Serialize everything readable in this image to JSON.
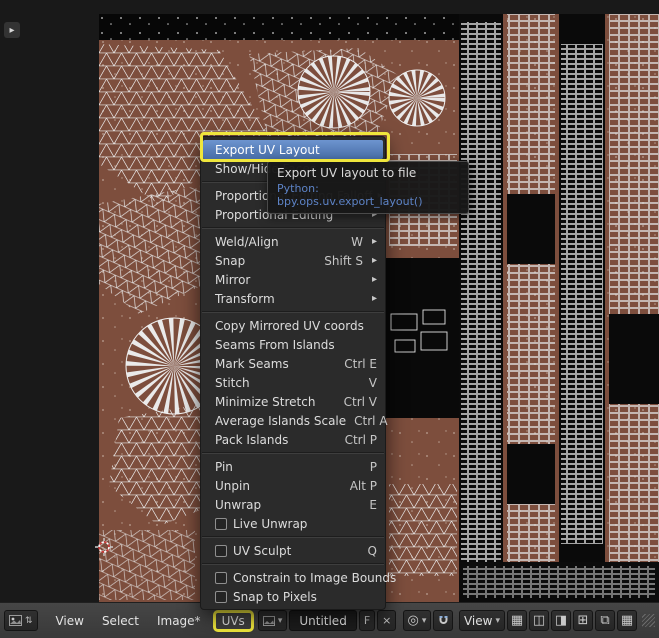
{
  "colors": {
    "canvas_brown": "#7d4e3d",
    "menu_bg": "#2b2b2b",
    "highlight_blue": "#5b83bd",
    "annotation_yellow": "#efe63c",
    "python_blue": "#5d83c6",
    "header_bg": "#3d3d3d"
  },
  "region": {
    "expand_arrow": "▸"
  },
  "tooltip": {
    "text": "Export UV layout to file",
    "python": "Python: bpy.ops.uv.export_layout()"
  },
  "menu": {
    "title": "UVs",
    "highlighted_item": "Export UV Layout",
    "items": [
      {
        "label": "Export UV Layout",
        "shortcut": ""
      },
      {
        "label": "Show/Hide Faces",
        "shortcut": ""
      },
      {
        "label": "Proportional Editing Falloff",
        "shortcut": ""
      },
      {
        "label": "Proportional Editing",
        "shortcut": ""
      },
      {
        "label": "Weld/Align",
        "shortcut": "W"
      },
      {
        "label": "Snap",
        "shortcut": "Shift S"
      },
      {
        "label": "Mirror",
        "shortcut": ""
      },
      {
        "label": "Transform",
        "shortcut": ""
      },
      {
        "label": "Copy Mirrored UV coords",
        "shortcut": ""
      },
      {
        "label": "Seams From Islands",
        "shortcut": ""
      },
      {
        "label": "Mark Seams",
        "shortcut": "Ctrl E"
      },
      {
        "label": "Stitch",
        "shortcut": "V"
      },
      {
        "label": "Minimize Stretch",
        "shortcut": "Ctrl V"
      },
      {
        "label": "Average Islands Scale",
        "shortcut": "Ctrl A"
      },
      {
        "label": "Pack Islands",
        "shortcut": "Ctrl P"
      },
      {
        "label": "Pin",
        "shortcut": "P"
      },
      {
        "label": "Unpin",
        "shortcut": "Alt P"
      },
      {
        "label": "Unwrap",
        "shortcut": "E"
      },
      {
        "label": "Live Unwrap",
        "shortcut": ""
      },
      {
        "label": "UV Sculpt",
        "shortcut": "Q"
      },
      {
        "label": "Constrain to Image Bounds",
        "shortcut": ""
      },
      {
        "label": "Snap to Pixels",
        "shortcut": ""
      }
    ]
  },
  "header": {
    "menu_view": "View",
    "menu_select": "Select",
    "menu_image": "Image*",
    "menu_uvs": "UVs",
    "image_name": "Untitled",
    "fake_user": "F",
    "unlink": "×",
    "draw_channel": "View"
  },
  "icons": {
    "submenu_arrow": "▸",
    "dropdown_arrow": "▾",
    "updown_arrow": "⇅",
    "pivot": "◎",
    "grid": "▦",
    "layers": "◫",
    "window": "⊞",
    "copy": "⧉",
    "half": "◨"
  }
}
